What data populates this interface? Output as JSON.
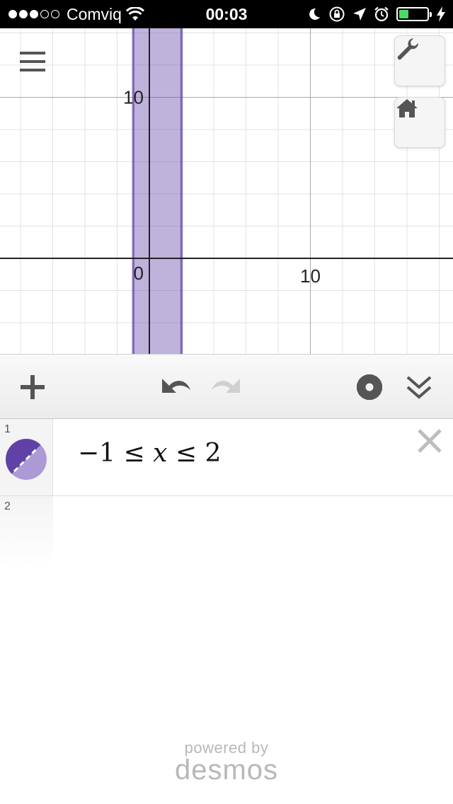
{
  "status_bar": {
    "carrier": "Comviq",
    "time": "00:03",
    "signal_dots_filled": 3,
    "signal_dots_total": 5,
    "battery_level": 0.35,
    "icons": [
      "wifi-icon",
      "moon-icon",
      "rotation-lock-icon",
      "location-icon",
      "alarm-icon",
      "battery-icon",
      "charging-icon"
    ]
  },
  "graph": {
    "x_axis_label": "10",
    "y_axis_label": "10",
    "origin_label": "0",
    "shaded_region": {
      "x_min": -1,
      "x_max": 2
    },
    "region_color": "#6042a6",
    "icons": [
      "menu-icon",
      "wrench-icon",
      "home-icon"
    ]
  },
  "toolbar": {
    "icons": [
      "add-icon",
      "undo-icon",
      "redo-icon",
      "settings-icon",
      "collapse-icon"
    ]
  },
  "expressions": [
    {
      "number": "1",
      "latex_parts": [
        "−1 ≤ ",
        "x",
        " ≤ 2"
      ],
      "color": "#6042a6"
    },
    {
      "number": "2",
      "latex_parts": [
        "",
        "",
        ""
      ]
    }
  ],
  "branding": {
    "powered_by": "powered by",
    "logo": "desmos"
  }
}
